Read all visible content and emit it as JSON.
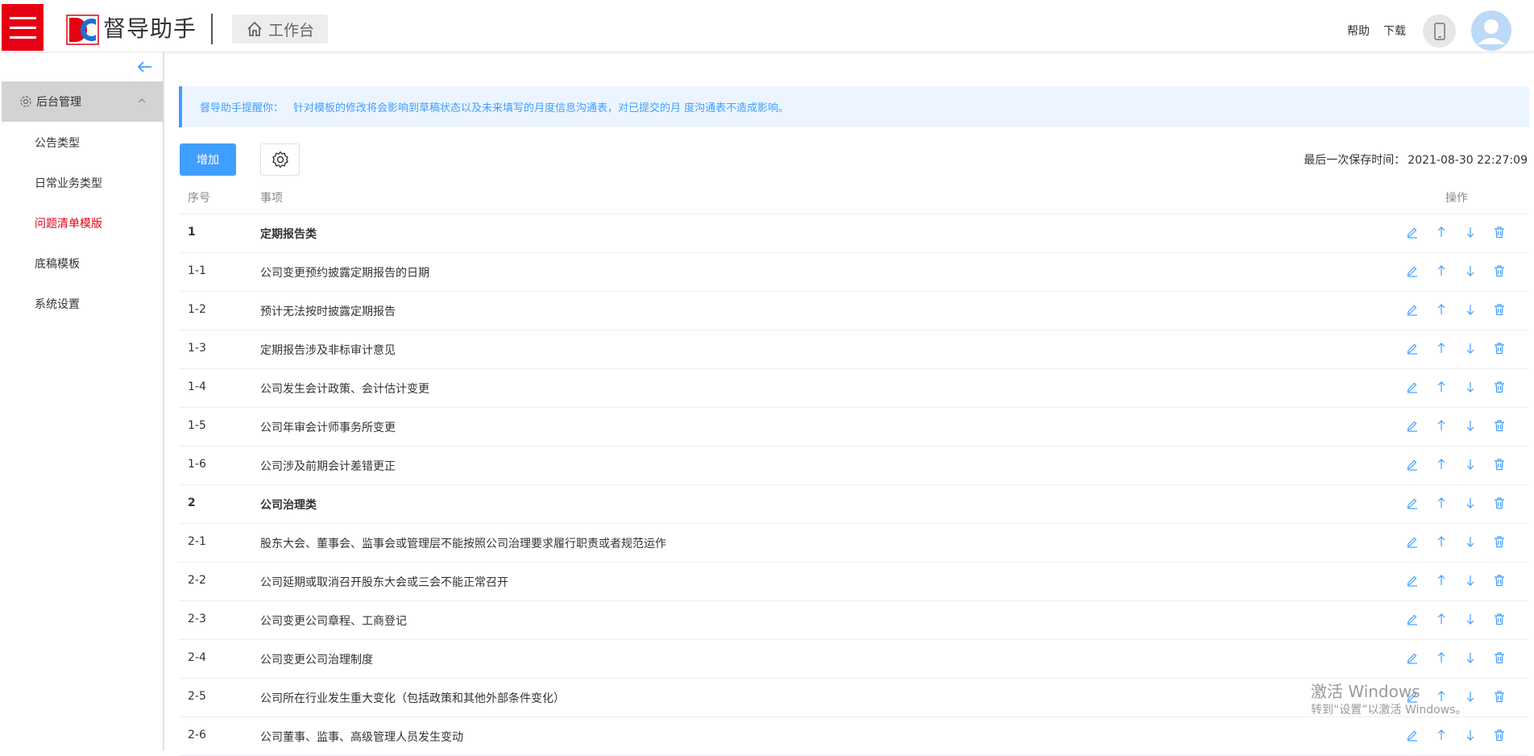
{
  "app": {
    "brand_name": "督导助手",
    "workbench_label": "工作台",
    "help_label": "帮助",
    "download_label": "下载",
    "brand_color": "#e60012",
    "accent_color": "#409eff"
  },
  "sidebar": {
    "group_label": "后台管理",
    "items": [
      {
        "label": "公告类型",
        "active": false
      },
      {
        "label": "日常业务类型",
        "active": false
      },
      {
        "label": "问题清单模版",
        "active": true
      },
      {
        "label": "底稿模板",
        "active": false
      },
      {
        "label": "系统设置",
        "active": false
      }
    ]
  },
  "notice": {
    "prefix": "督导助手提醒你：",
    "text": "针对模板的修改将会影响到草稿状态以及未来填写的月度信息沟通表，对已提交的月 度沟通表不造成影响。"
  },
  "toolbar": {
    "add_label": "增加",
    "save_time_label": "最后一次保存时间：",
    "save_time_value": "2021-08-30 22:27:09"
  },
  "table": {
    "headers": {
      "no": "序号",
      "item": "事项",
      "op": "操作"
    },
    "rows": [
      {
        "no": "1",
        "item": "定期报告类",
        "bold": true
      },
      {
        "no": "1-1",
        "item": "公司变更预约披露定期报告的日期",
        "bold": false
      },
      {
        "no": "1-2",
        "item": "预计无法按时披露定期报告",
        "bold": false
      },
      {
        "no": "1-3",
        "item": "定期报告涉及非标审计意见",
        "bold": false
      },
      {
        "no": "1-4",
        "item": "公司发生会计政策、会计估计变更",
        "bold": false
      },
      {
        "no": "1-5",
        "item": "公司年审会计师事务所变更",
        "bold": false
      },
      {
        "no": "1-6",
        "item": "公司涉及前期会计差错更正",
        "bold": false
      },
      {
        "no": "2",
        "item": "公司治理类",
        "bold": true
      },
      {
        "no": "2-1",
        "item": "股东大会、董事会、监事会或管理层不能按照公司治理要求履行职责或者规范运作",
        "bold": false
      },
      {
        "no": "2-2",
        "item": "公司延期或取消召开股东大会或三会不能正常召开",
        "bold": false
      },
      {
        "no": "2-3",
        "item": "公司变更公司章程、工商登记",
        "bold": false
      },
      {
        "no": "2-4",
        "item": "公司变更公司治理制度",
        "bold": false
      },
      {
        "no": "2-5",
        "item": "公司所在行业发生重大变化（包括政策和其他外部条件变化）",
        "bold": false
      },
      {
        "no": "2-6",
        "item": "公司董事、监事、高级管理人员发生变动",
        "bold": false
      }
    ],
    "row_ops": [
      "edit-icon",
      "arrow-up-icon",
      "arrow-down-icon",
      "delete-icon"
    ]
  },
  "watermark": {
    "line1": "激活 Windows",
    "line2": "转到“设置”以激活 Windows。"
  }
}
